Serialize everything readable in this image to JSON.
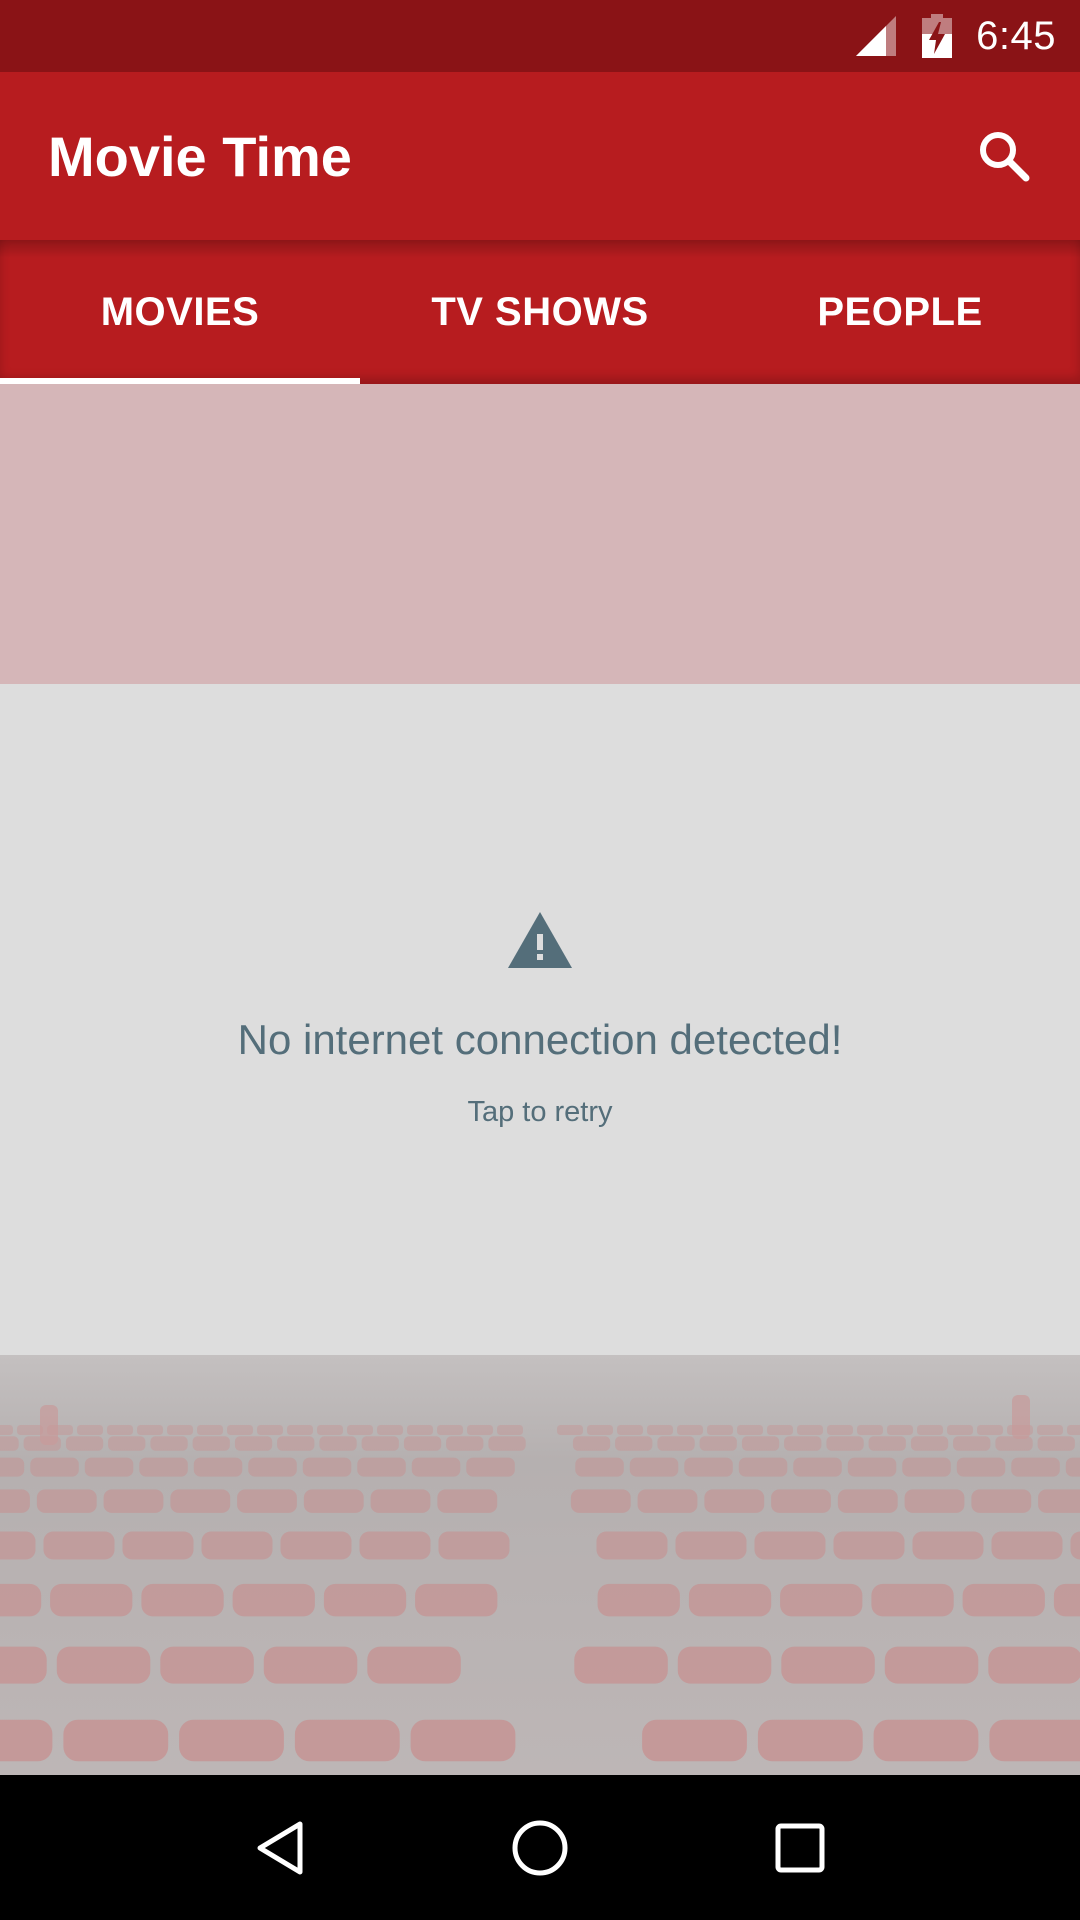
{
  "status_bar": {
    "time": "6:45",
    "signal_icon": "cell-signal-icon",
    "battery_icon": "battery-charging-icon"
  },
  "app_bar": {
    "title": "Movie Time",
    "search_icon": "search-icon"
  },
  "tabs": [
    {
      "label": "MOVIES",
      "active": true
    },
    {
      "label": "TV SHOWS",
      "active": false
    },
    {
      "label": "PEOPLE",
      "active": false
    }
  ],
  "error": {
    "icon": "warning-icon",
    "title": "No internet connection detected!",
    "action": "Tap to retry"
  },
  "nav_bar": {
    "back_icon": "back-icon",
    "home_icon": "home-icon",
    "recents_icon": "recents-icon"
  },
  "colors": {
    "status_bar": "#8a1316",
    "primary": "#b71c1f",
    "band": "#d5b6b8",
    "panel": "#dddddd",
    "error_text": "#546e7a"
  }
}
